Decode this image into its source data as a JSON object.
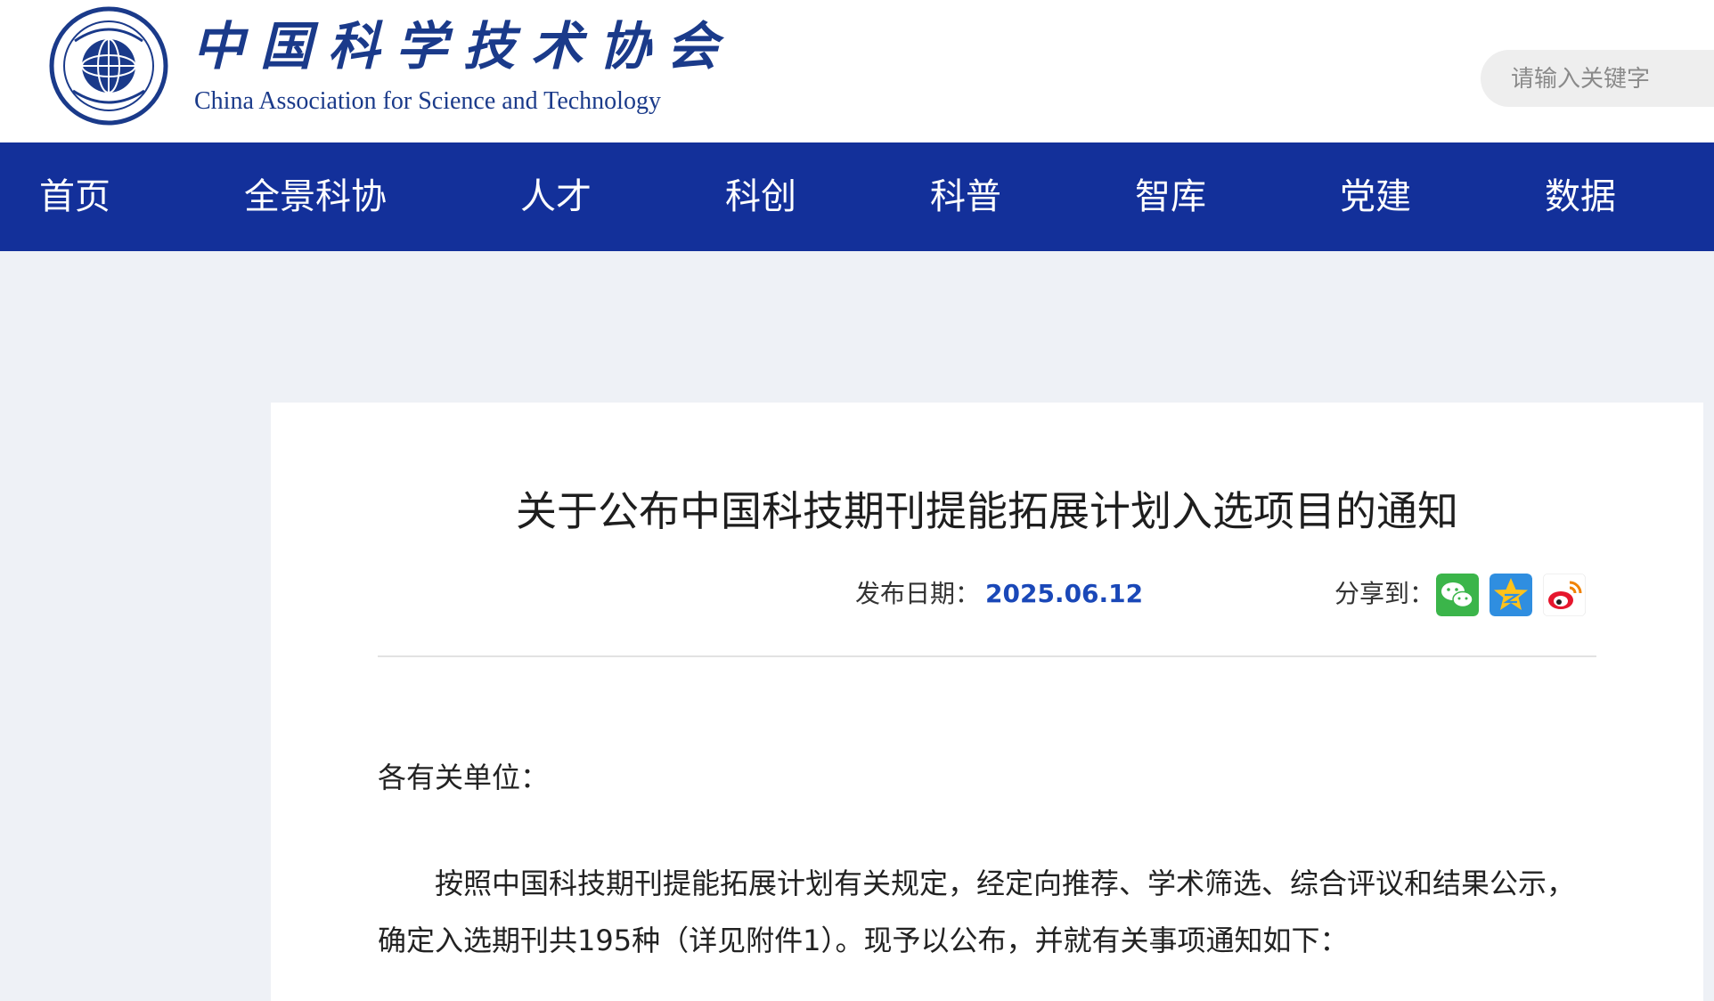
{
  "header": {
    "logo_cn": "中国科学技术协会",
    "logo_en": "China Association for Science and Technology",
    "search_placeholder": "请输入关键字"
  },
  "nav": {
    "items": [
      {
        "label": "首页"
      },
      {
        "label": "全景科协"
      },
      {
        "label": "人才"
      },
      {
        "label": "科创"
      },
      {
        "label": "科普"
      },
      {
        "label": "智库"
      },
      {
        "label": "党建"
      },
      {
        "label": "数据"
      }
    ]
  },
  "article": {
    "title": "关于公布中国科技期刊提能拓展计划入选项目的通知",
    "date_label": "发布日期：",
    "date": "2025.06.12",
    "share_label": "分享到：",
    "share_icons": [
      "wechat-icon",
      "qzone-icon",
      "weibo-icon"
    ],
    "greeting": "各有关单位：",
    "paragraph_lines": [
      "按照中国科技期刊提能拓展计划有关规定，经定向推荐、学术筛选、综合评议和结果公示，",
      "确定入选期刊共195种（详见附件1）。现予以公布，并就有关事项通知如下："
    ]
  },
  "colors": {
    "brand_blue": "#13309a",
    "logo_blue": "#1a3a8a",
    "date_blue": "#1a48b8",
    "page_bg": "#eef1f6"
  }
}
